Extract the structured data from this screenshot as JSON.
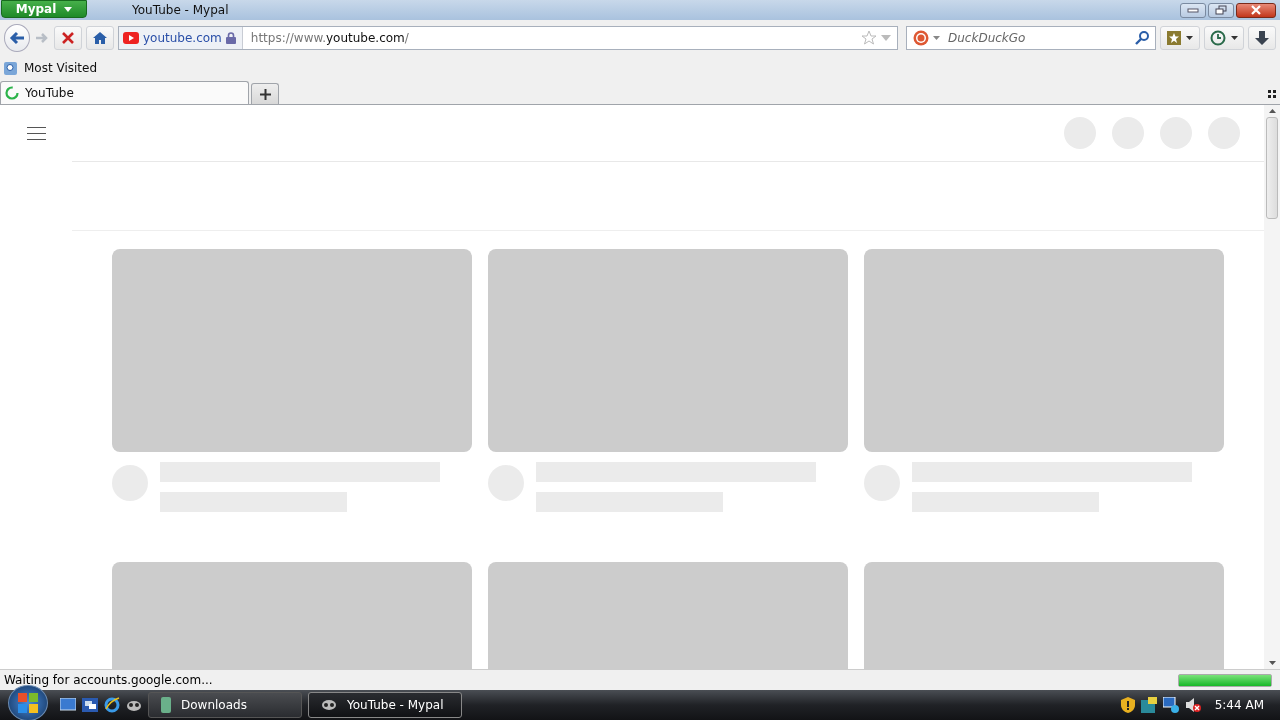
{
  "window": {
    "title": "YouTube - Mypal",
    "app_menu": "Mypal"
  },
  "navigation": {
    "identity": "youtube.com",
    "url": {
      "scheme": "https://www.",
      "host": "youtube.com",
      "path": "/"
    },
    "search_placeholder": "DuckDuckGo"
  },
  "bookmarks": [
    {
      "label": "Most Visited"
    }
  ],
  "tabs": [
    {
      "label": "YouTube",
      "selected": true,
      "loading": true
    }
  ],
  "page": {
    "header_placeholders": [
      {
        "kind": "circle"
      },
      {
        "kind": "circle"
      },
      {
        "kind": "circle"
      },
      {
        "kind": "circle"
      }
    ],
    "cards": [
      {
        "kind": "full"
      },
      {
        "kind": "full"
      },
      {
        "kind": "full"
      },
      {
        "kind": "cut"
      },
      {
        "kind": "cut"
      },
      {
        "kind": "cut"
      }
    ]
  },
  "status_bar": {
    "text": "Waiting for accounts.google.com...",
    "level": 1
  },
  "taskbar": {
    "buttons": [
      {
        "label": "Downloads",
        "selected": false
      },
      {
        "label": "YouTube - Mypal",
        "selected": true
      }
    ],
    "clock": "5:44 AM"
  }
}
